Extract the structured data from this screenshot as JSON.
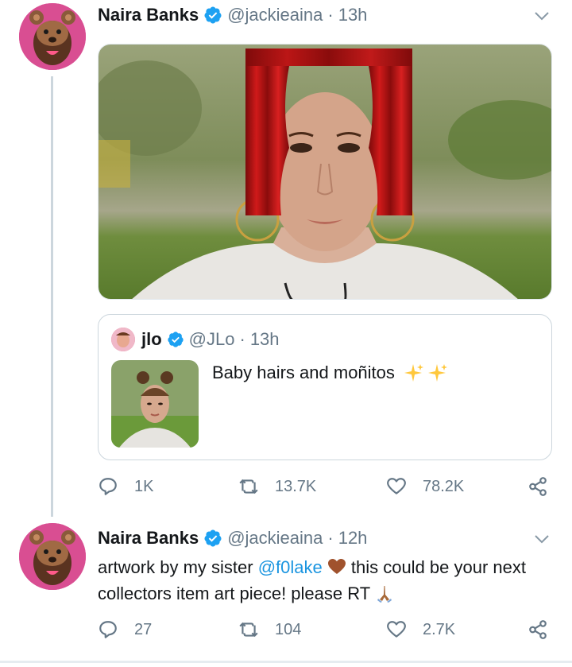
{
  "tweet1": {
    "name": "Naira Banks",
    "handle": "@jackieaina",
    "dot": "·",
    "time": "13h",
    "quote": {
      "name": "jlo",
      "handle": "@JLo",
      "dot": "·",
      "time": "13h",
      "text": "Baby hairs and moñitos"
    },
    "actions": {
      "reply_count": "1K",
      "retweet_count": "13.7K",
      "like_count": "78.2K"
    }
  },
  "tweet2": {
    "name": "Naira Banks",
    "handle": "@jackieaina",
    "dot": "·",
    "time": "12h",
    "text_part1": "artwork by my sister ",
    "mention": "@f0lake",
    "text_part2": " this could be your next collectors item art piece! please RT ",
    "actions": {
      "reply_count": "27",
      "retweet_count": "104",
      "like_count": "2.7K"
    }
  },
  "icons": {
    "verified": "verified-badge-icon",
    "chevron": "chevron-down-icon",
    "reply": "reply-icon",
    "retweet": "retweet-icon",
    "like": "heart-icon",
    "share": "share-icon",
    "sparkles": "sparkles-emoji",
    "brown_heart": "brown-heart-emoji",
    "praying_hands": "praying-hands-emoji"
  },
  "colors": {
    "text": "#14171a",
    "secondary": "#657786",
    "link": "#1b95e0",
    "verified": "#1da1f2",
    "border": "#ccd6dd"
  }
}
